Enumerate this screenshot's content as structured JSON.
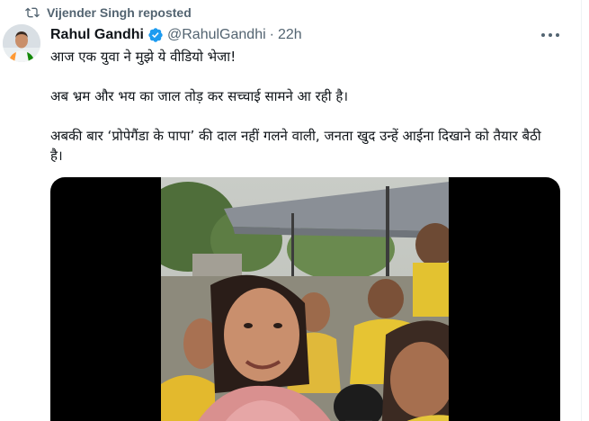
{
  "repost": {
    "icon": "repost-icon",
    "text": "Vijender Singh reposted"
  },
  "author": {
    "name": "Rahul Gandhi",
    "handle": "@RahulGandhi",
    "separator": "·",
    "time": "22h",
    "verified_icon": "verified-badge-icon",
    "verified_color": "#1d9bf0"
  },
  "tweet": {
    "paragraphs": [
      "आज एक युवा ने मुझे ये वीडियो भेजा!",
      "अब भ्रम और भय का जाल तोड़ कर सच्चाई सामने आ रही है।",
      "अबकी बार ‘प्रोपेगैंडा के पापा’ की दाल नहीं गलने वाली, जनता खुद उन्हें आईना दिखाने को तैयार बैठी है।"
    ]
  },
  "media": {
    "type": "video"
  },
  "colors": {
    "text": "#0f1419",
    "secondary": "#536471",
    "accent": "#1d9bf0"
  }
}
